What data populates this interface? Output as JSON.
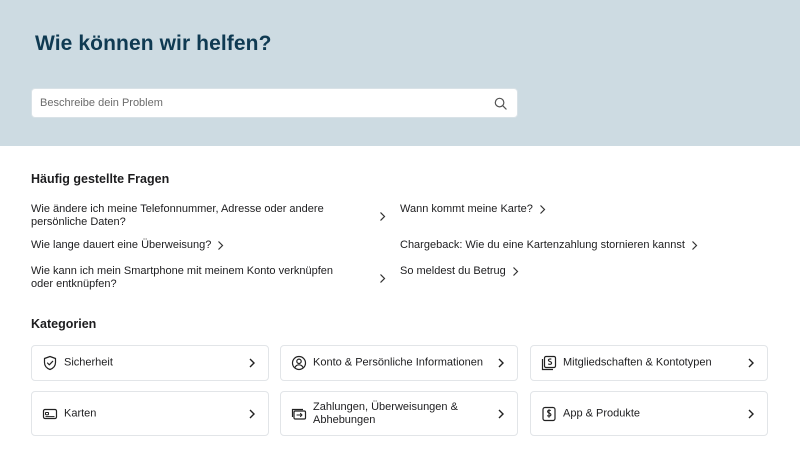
{
  "hero": {
    "title": "Wie können wir helfen?",
    "search_placeholder": "Beschreibe dein Problem",
    "search_icon": "search-icon",
    "background": "#cddbe2"
  },
  "faq": {
    "title": "Häufig gestellte Fragen",
    "items": [
      {
        "label": "Wie ändere ich meine Telefonnummer, Adresse oder andere persönliche Daten?"
      },
      {
        "label": "Wann kommt meine Karte?"
      },
      {
        "label": "Wie lange dauert eine Überweisung?"
      },
      {
        "label": "Chargeback: Wie du eine Kartenzahlung stornieren kannst"
      },
      {
        "label": "Wie kann ich mein Smartphone mit meinem Konto verknüpfen oder entknüpfen?"
      },
      {
        "label": "So meldest du Betrug"
      }
    ]
  },
  "categories": {
    "title": "Kategorien",
    "items": [
      {
        "label": "Sicherheit",
        "icon": "shield-icon"
      },
      {
        "label": "Konto & Persönliche Informationen",
        "icon": "user-icon"
      },
      {
        "label": "Mitgliedschaften & Kontotypen",
        "icon": "membership-icon"
      },
      {
        "label": "Karten",
        "icon": "card-icon"
      },
      {
        "label": "Zahlungen, Überweisungen & Abhebungen",
        "icon": "transfer-icon"
      },
      {
        "label": "App & Produkte",
        "icon": "app-icon"
      }
    ]
  }
}
